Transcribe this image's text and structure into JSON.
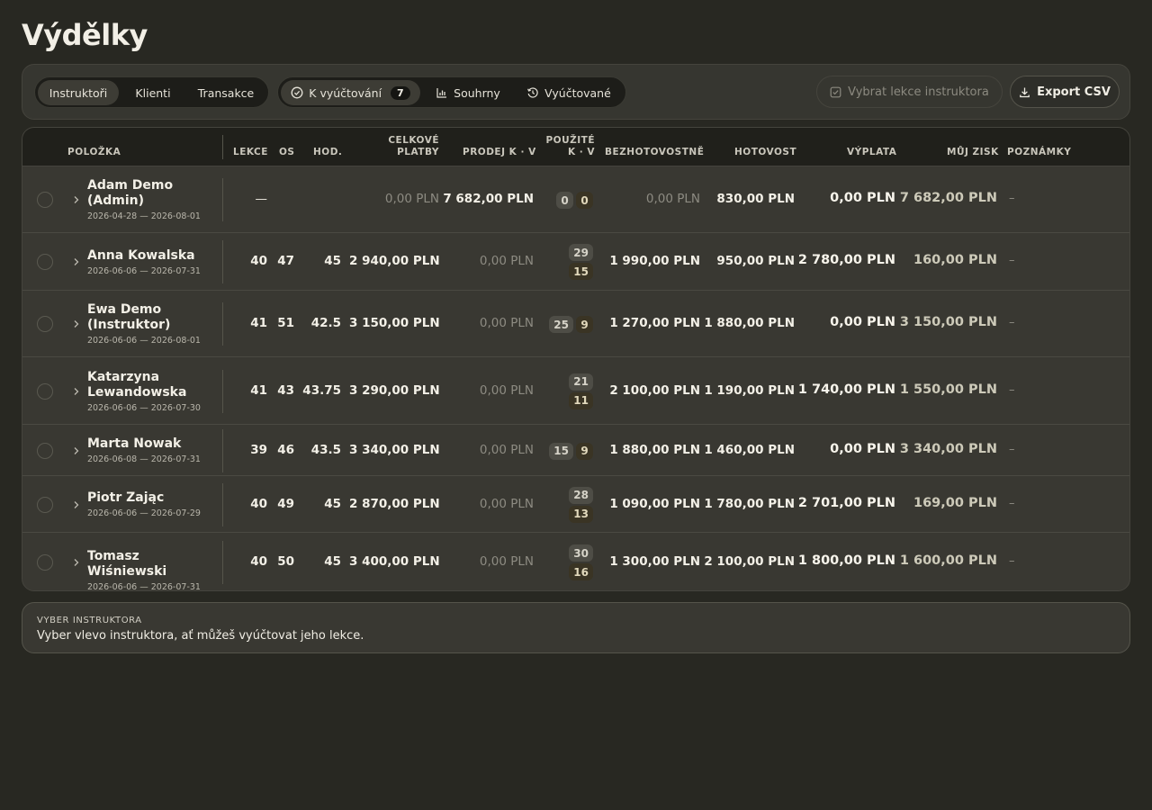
{
  "page_title": "Výdělky",
  "toolbar": {
    "tabs_primary": [
      "Instruktoři",
      "Klienti",
      "Transakce"
    ],
    "tabs_secondary": [
      {
        "label": "K vyúčtování",
        "count": "7",
        "icon": "check-circle-icon"
      },
      {
        "label": "Souhrny",
        "icon": "bar-chart-icon"
      },
      {
        "label": "Vyúčtované",
        "icon": "history-icon"
      }
    ],
    "select_lessons_label": "Vybrat lekce instruktora",
    "export_label": "Export CSV"
  },
  "table": {
    "headers": {
      "item": "Položka",
      "lessons": "Lekce",
      "os": "Os",
      "hours": "Hod.",
      "total_1": "Celkové",
      "total_2": "platby",
      "sales": "Prodej K · V",
      "used_1": "Použité",
      "used_2": "K · V",
      "card": "Bezhotovostně",
      "cash": "Hotovost",
      "payout": "Výplata",
      "profit": "Můj zisk",
      "notes": "Poznámky"
    },
    "rows": [
      {
        "name": "Adam Demo (Admin)",
        "dates": "2026-04-28 — 2026-08-01",
        "lessons": "—",
        "os": "",
        "hours": "",
        "total": "0,00 PLN",
        "sales": "7 682,00 PLN",
        "used_k": "0",
        "used_v": "0",
        "card": "0,00 PLN",
        "cash": "830,00 PLN",
        "payout": "0,00 PLN",
        "profit": "7 682,00 PLN",
        "notes": "–"
      },
      {
        "name": "Anna Kowalska",
        "dates": "2026-06-06 — 2026-07-31",
        "lessons": "40",
        "os": "47",
        "hours": "45",
        "total": "2 940,00 PLN",
        "sales": "0,00 PLN",
        "used_k": "29",
        "used_v": "15",
        "card": "1 990,00 PLN",
        "cash": "950,00 PLN",
        "payout": "2 780,00 PLN",
        "profit": "160,00 PLN",
        "notes": "–"
      },
      {
        "name": "Ewa Demo (Instruktor)",
        "dates": "2026-06-06 — 2026-08-01",
        "lessons": "41",
        "os": "51",
        "hours": "42.5",
        "total": "3 150,00 PLN",
        "sales": "0,00 PLN",
        "used_k": "25",
        "used_v": "9",
        "card": "1 270,00 PLN",
        "cash": "1 880,00 PLN",
        "payout": "0,00 PLN",
        "profit": "3 150,00 PLN",
        "notes": "–"
      },
      {
        "name": "Katarzyna Lewandowska",
        "dates": "2026-06-06 — 2026-07-30",
        "lessons": "41",
        "os": "43",
        "hours": "43.75",
        "total": "3 290,00 PLN",
        "sales": "0,00 PLN",
        "used_k": "21",
        "used_v": "11",
        "card": "2 100,00 PLN",
        "cash": "1 190,00 PLN",
        "payout": "1 740,00 PLN",
        "profit": "1 550,00 PLN",
        "notes": "–"
      },
      {
        "name": "Marta Nowak",
        "dates": "2026-06-08 — 2026-07-31",
        "lessons": "39",
        "os": "46",
        "hours": "43.5",
        "total": "3 340,00 PLN",
        "sales": "0,00 PLN",
        "used_k": "15",
        "used_v": "9",
        "card": "1 880,00 PLN",
        "cash": "1 460,00 PLN",
        "payout": "0,00 PLN",
        "profit": "3 340,00 PLN",
        "notes": "–"
      },
      {
        "name": "Piotr Zając",
        "dates": "2026-06-06 — 2026-07-29",
        "lessons": "40",
        "os": "49",
        "hours": "45",
        "total": "2 870,00 PLN",
        "sales": "0,00 PLN",
        "used_k": "28",
        "used_v": "13",
        "card": "1 090,00 PLN",
        "cash": "1 780,00 PLN",
        "payout": "2 701,00 PLN",
        "profit": "169,00 PLN",
        "notes": "–"
      },
      {
        "name": "Tomasz Wiśniewski",
        "dates": "2026-06-06 — 2026-07-31",
        "lessons": "40",
        "os": "50",
        "hours": "45",
        "total": "3 400,00 PLN",
        "sales": "0,00 PLN",
        "used_k": "30",
        "used_v": "16",
        "card": "1 300,00 PLN",
        "cash": "2 100,00 PLN",
        "payout": "1 800,00 PLN",
        "profit": "1 600,00 PLN",
        "notes": "–"
      }
    ]
  },
  "info_panel": {
    "label": "VYBER INSTRUKTORA",
    "text": "Vyber vlevo instruktora, ať můžeš vyúčtovat jeho lekce."
  }
}
